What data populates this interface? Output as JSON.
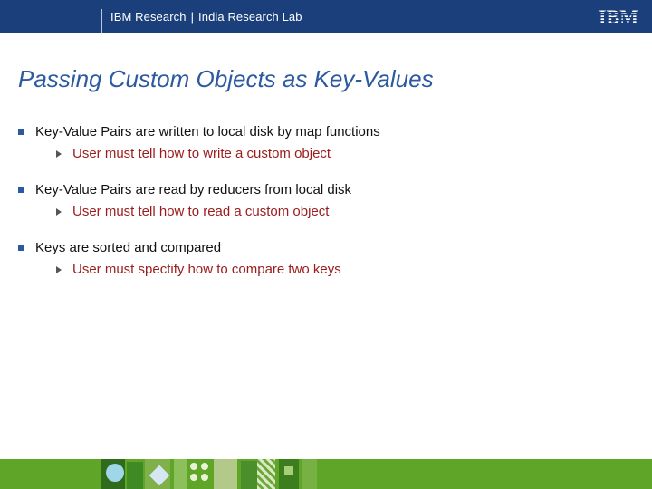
{
  "header": {
    "org": "IBM Research",
    "lab": "India Research Lab",
    "logo_text": "IBM"
  },
  "slide": {
    "title": "Passing Custom Objects as Key-Values",
    "bullets": [
      {
        "text": "Key-Value Pairs are written to local disk by map functions",
        "sub": "User must tell how to write a custom object"
      },
      {
        "text": "Key-Value Pairs are read by reducers from local disk",
        "sub": "User must tell how to read a custom object"
      },
      {
        "text": "Keys are sorted and compared",
        "sub": "User must spectify how to compare two keys"
      }
    ]
  },
  "colors": {
    "header_bg": "#1a3f7a",
    "title": "#2b5aa0",
    "sub_bullet_text": "#9b1c1c",
    "footer_bg": "#5fa528"
  }
}
